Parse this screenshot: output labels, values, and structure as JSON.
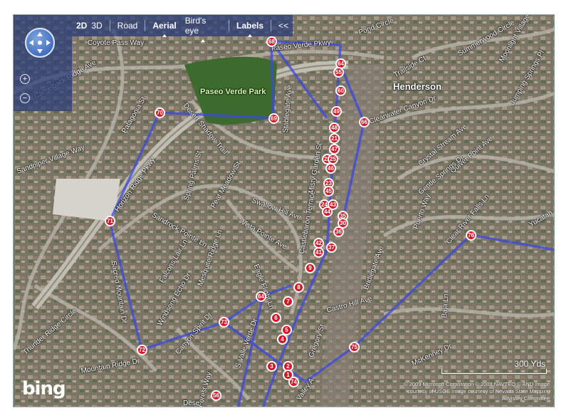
{
  "toolbar": {
    "mode_2d": "2D",
    "mode_3d": "3D",
    "road": "Road",
    "aerial": "Aerial",
    "birds_eye": "Bird's eye",
    "labels": "Labels",
    "collapse": "<<"
  },
  "nav": {
    "zoom_in": "+",
    "zoom_out": "−"
  },
  "place_labels": {
    "henderson": "Henderson",
    "park": "Paseo Verde Park"
  },
  "streets": [
    "Coyote Pass Way",
    "Paseo Verde Pkwy",
    "Camelback Ridge Ave",
    "Patagonia St",
    "Desert Shadow Trail",
    "Stablegate Ave",
    "Pond Circle",
    "Summerwood Circle",
    "Moonlight Village",
    "Trailside Ct",
    "Clearwater Canyon Dr",
    "Misty Garden St",
    "Spring Palms St",
    "Peat Meadow St",
    "Swallow Hill Ave",
    "Vista Pointe Ave",
    "Castlebaron Terrace",
    "Eagle Flight Ln",
    "Sandrock Pointe Ln",
    "Falcons Lair Ln",
    "Mesquite Ridge Ln",
    "Windsong Echo Dr",
    "Sacred Mountain Dr",
    "Canyon Spirit Dr",
    "Thunder Ridge Circle",
    "Mountain Ridge Dr",
    "Crystal Stream Ave",
    "Quiver Point Ave",
    "Gentle Springs Dr",
    "Puerto Way",
    "Clear River Falls Ln",
    "Castro Hill Ave",
    "Bridlegate Ave",
    "Baja Ln",
    "Yucatan",
    "McKenney Dr",
    "S Valle Verde Dr",
    "Sandpiper Village Way",
    "Jumping Springs Pl",
    "Gregory St",
    "Horizon Ridge Pkwy",
    "Forest Way",
    "Valley A",
    "Dese"
  ],
  "markers": [
    "68",
    "64",
    "55",
    "60",
    "70",
    "69",
    "49",
    "66",
    "48",
    "21",
    "47",
    "22",
    "25",
    "46",
    "23",
    "45",
    "24",
    "43",
    "44",
    "35",
    "30",
    "36",
    "42",
    "41",
    "37",
    "9",
    "8",
    "7",
    "64",
    "6",
    "5",
    "4",
    "3",
    "2",
    "1",
    "74",
    "75",
    "73",
    "72",
    "71",
    "76",
    "56"
  ],
  "scale_label": "300 Yds",
  "copyright": "© 2009 Microsoft Corporation © 2009 NAVTEQ © AND Image courtesy of USGS Image courtesy of Nevada State Mapping Advisory Committee",
  "logo": "bing"
}
